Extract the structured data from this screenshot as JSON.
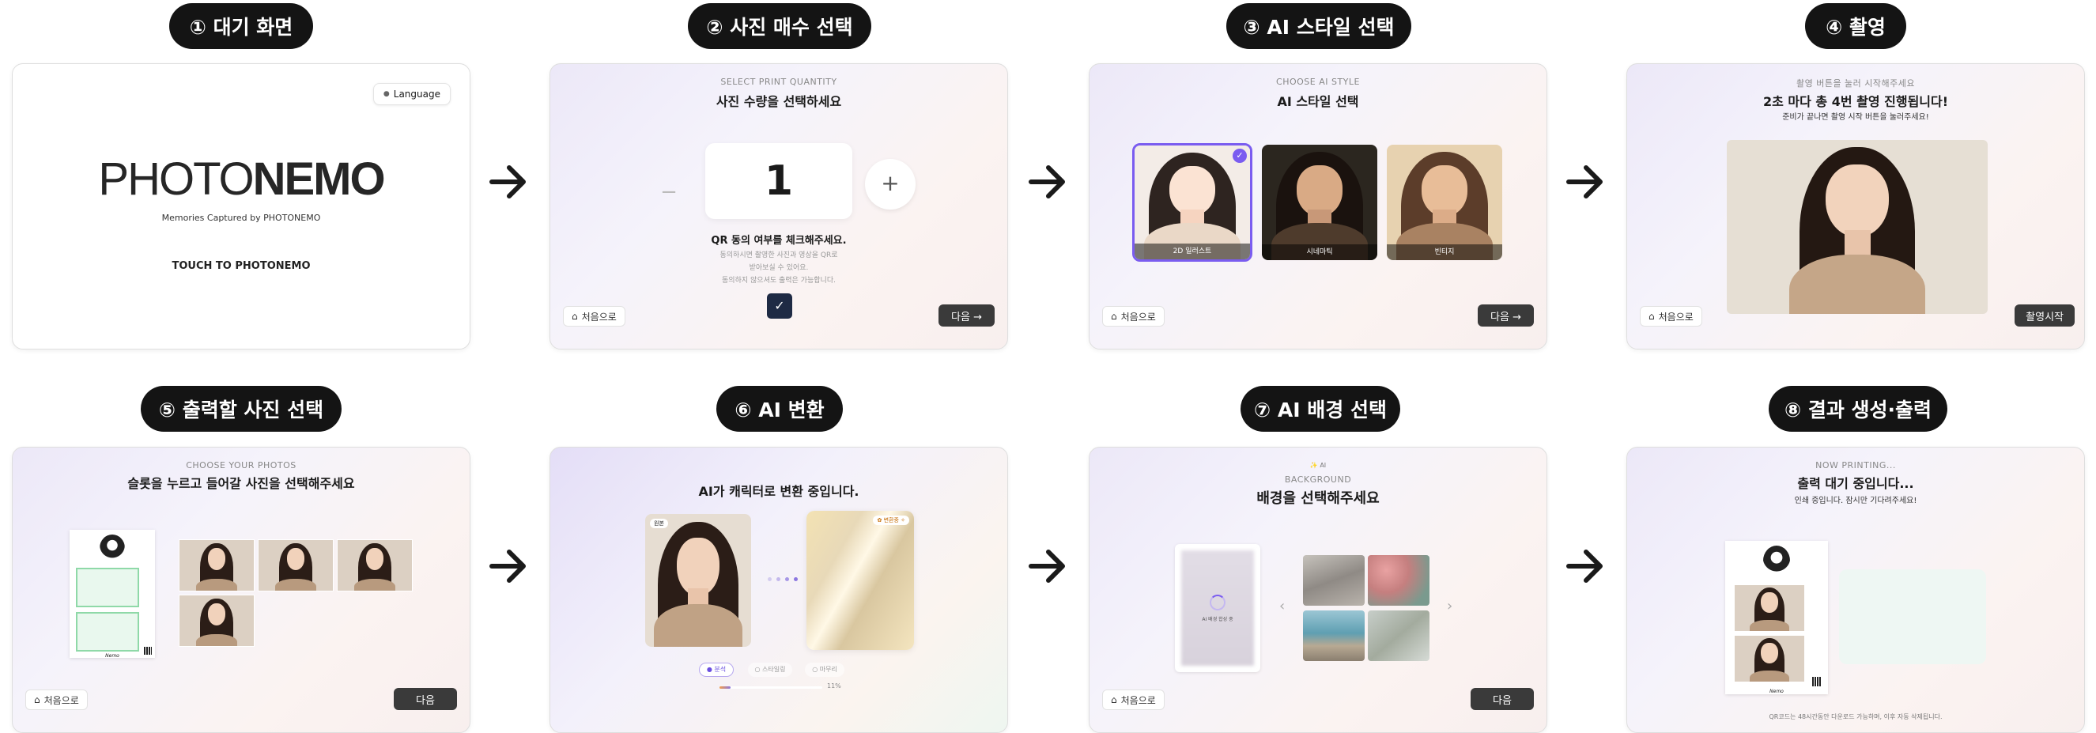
{
  "steps": [
    {
      "label": "① 대기 화면"
    },
    {
      "label": "② 사진 매수 선택"
    },
    {
      "label": "③ AI 스타일 선택"
    },
    {
      "label": "④ 촬영"
    },
    {
      "label": "⑤ 출력할 사진 선택"
    },
    {
      "label": "⑥ AI 변환"
    },
    {
      "label": "⑦ AI 배경 선택"
    },
    {
      "label": "⑧ 결과 생성·출력"
    }
  ],
  "common": {
    "home": "처음으로",
    "next": "다음",
    "next_arrow": "다음 →"
  },
  "s1": {
    "language": "Language",
    "logo_light": "PHOTO",
    "logo_bold": "NEMO",
    "tagline": "Memories Captured by PHOTONEMO",
    "touch": "TOUCH TO PHOTONEMO"
  },
  "s2": {
    "sub": "SELECT PRINT QUANTITY",
    "title": "사진 수량을 선택하세요",
    "minus": "−",
    "count": "1",
    "plus": "+",
    "qr_title": "QR 동의 여부를 체크해주세요.",
    "qr_l1": "동의하시면 촬영한 사진과 영상을 QR로",
    "qr_l2": "받아보실 수 있어요.",
    "qr_l3": "동의하지 않으셔도 출력은 가능합니다."
  },
  "s3": {
    "sub": "CHOOSE AI STYLE",
    "title": "AI 스타일 선택",
    "styles": [
      "2D 일러스트",
      "시네마틱",
      "빈티지"
    ]
  },
  "s4": {
    "sub": "촬영 버튼을 눌러 시작해주세요",
    "title": "2초 마다 총 4번 촬영 진행됩니다!",
    "desc": "준비가 끝나면 촬영 시작 버튼을 눌러주세요!",
    "start": "촬영시작"
  },
  "s5": {
    "sub": "CHOOSE YOUR PHOTOS",
    "title": "슬롯을 누르고 들어갈 사진을 선택해주세요",
    "frame_caption": "Nemo"
  },
  "s6": {
    "title": "AI가 캐릭터로 변환 중입니다.",
    "original_badge": "원본",
    "converting_badge": "✿ 변환중 ✧",
    "steps": [
      "● 분석",
      "○ 스타일링",
      "○ 마무리"
    ],
    "progress_text": "11%",
    "progress": 0.11
  },
  "s7": {
    "tag": "✨ AI",
    "sub": "BACKGROUND",
    "title": "배경을 선택해주세요",
    "preview_label": "AI 배경 합성 중",
    "prev": "‹",
    "next_chev": "›"
  },
  "s8": {
    "sub": "NOW PRINTING...",
    "title": "출력 대기 중입니다...",
    "desc": "인쇄 중입니다. 잠시만 기다려주세요!",
    "footer": "QR코드는 48시간동안 다운로드 가능하며, 이후 자동 삭제됩니다.",
    "frame_caption": "Nemo"
  }
}
